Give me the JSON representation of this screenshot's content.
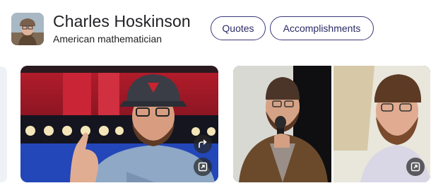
{
  "entity": {
    "name": "Charles Hoskinson",
    "description": "American mathematician"
  },
  "chips": [
    {
      "label": "Quotes"
    },
    {
      "label": "Accomplishments"
    }
  ],
  "icons": {
    "share": "share-icon",
    "expand": "expand-image-icon"
  }
}
